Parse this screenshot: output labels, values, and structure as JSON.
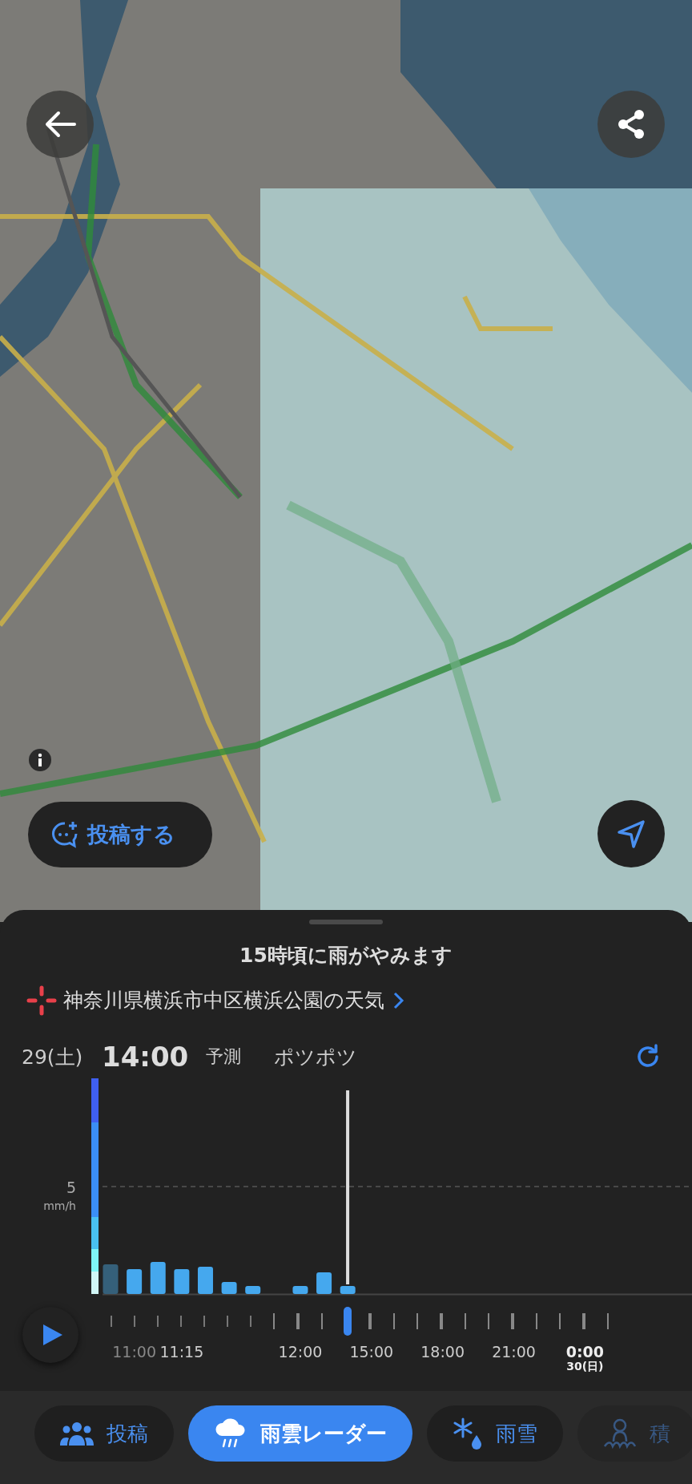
{
  "map": {
    "post_button": {
      "label": "投稿する"
    }
  },
  "sheet": {
    "headline": "15時頃に雨がやみます",
    "location": "神奈川県横浜市中区横浜公園の天気",
    "date": "29(土)",
    "time": "14:00",
    "mode": "予測",
    "intensity": "ポツポツ",
    "axis": {
      "value": "5",
      "unit": "mm/h"
    },
    "timeline": {
      "level": 0.476,
      "labels": [
        {
          "text": "11:00",
          "kind": "past"
        },
        {
          "text": "11:15",
          "kind": "time"
        },
        {
          "text": "12:00",
          "kind": "time"
        },
        {
          "text": "15:00",
          "kind": "time"
        },
        {
          "text": "18:00",
          "kind": "time"
        },
        {
          "text": "21:00",
          "kind": "time"
        },
        {
          "text": "0:00",
          "sub": "30(日)",
          "kind": "day"
        }
      ]
    }
  },
  "tabs": [
    {
      "label": "投稿",
      "selected": false
    },
    {
      "label": "雨雲レーダー",
      "selected": true
    },
    {
      "label": "雨雪",
      "selected": false
    },
    {
      "label": "積",
      "selected": false
    }
  ]
}
